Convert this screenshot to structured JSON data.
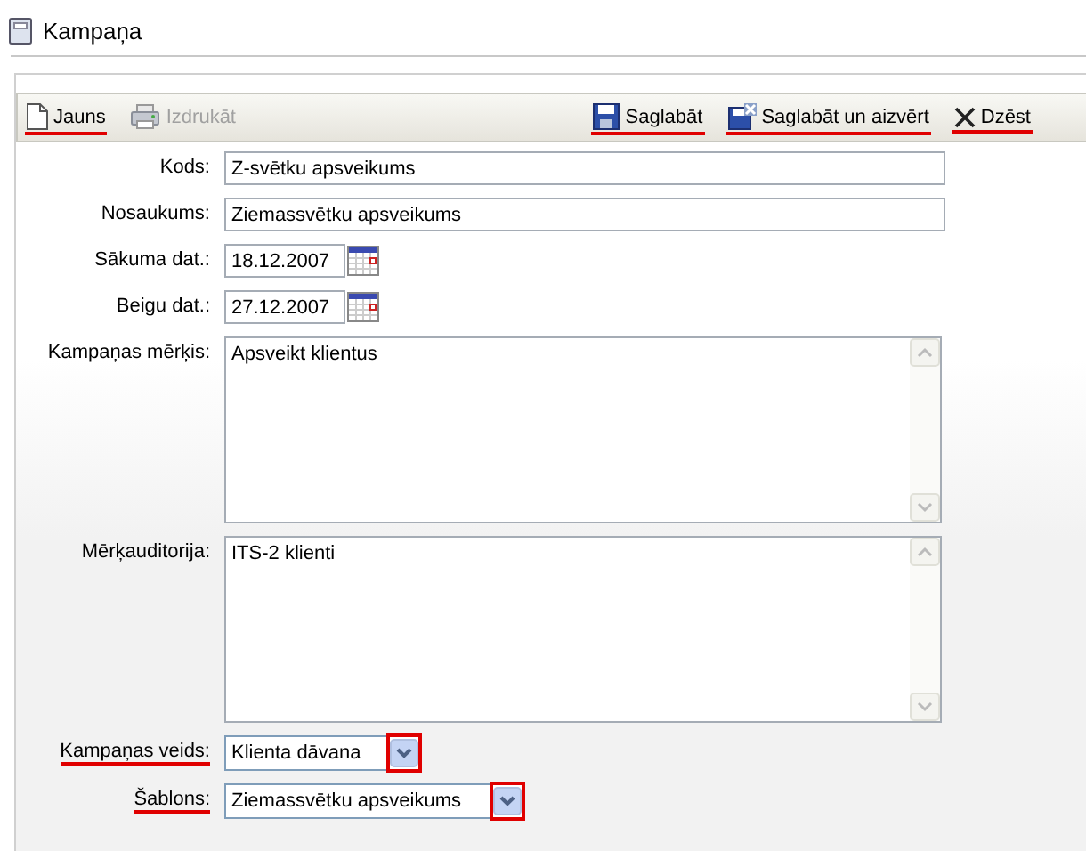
{
  "window": {
    "title": "Kampaņa"
  },
  "toolbar": [
    {
      "label": "Jauns",
      "disabled": false,
      "highlighted": true
    },
    {
      "label": "Izdrukāt",
      "disabled": true,
      "highlighted": false
    },
    {
      "label": "Saglabāt",
      "disabled": false,
      "highlighted": true
    },
    {
      "label": "Saglabāt un aizvērt",
      "disabled": false,
      "highlighted": true
    },
    {
      "label": "Dzēst",
      "disabled": false,
      "highlighted": true
    }
  ],
  "fields": [
    {
      "kind": "text",
      "label": "Kods:",
      "value": "Z-svētku apsveikums",
      "highlighted": false
    },
    {
      "kind": "text",
      "label": "Nosaukums:",
      "value": "Ziemassvētku apsveikums",
      "highlighted": false
    },
    {
      "kind": "date",
      "label": "Sākuma dat.:",
      "value": "18.12.2007",
      "highlighted": false
    },
    {
      "kind": "date",
      "label": "Beigu dat.:",
      "value": "27.12.2007",
      "highlighted": false
    },
    {
      "kind": "textarea",
      "label": "Kampaņas mērķis:",
      "value": "Apsveikt klientus",
      "highlighted": false
    },
    {
      "kind": "textarea",
      "label": "Mērķauditorija:",
      "value": "ITS-2 klienti",
      "highlighted": false
    },
    {
      "kind": "select",
      "label": "Kampaņas veids:",
      "value": "Klienta dāvana",
      "highlighted": true
    },
    {
      "kind": "select",
      "label": "Šablons:",
      "value": "Ziemassvētku apsveikums",
      "highlighted": true
    }
  ]
}
